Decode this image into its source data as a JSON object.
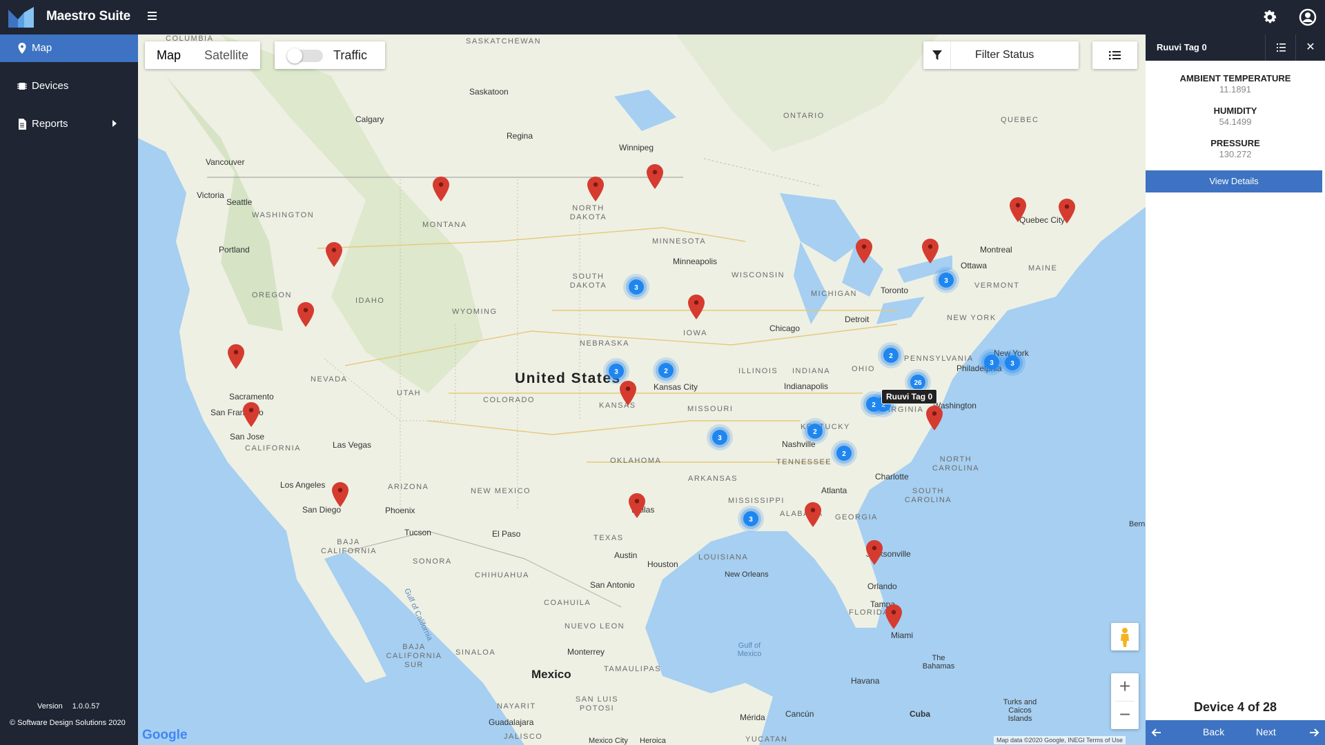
{
  "app": {
    "title": "Maestro Suite"
  },
  "sidebar": {
    "items": [
      {
        "label": "Map",
        "icon": "map-marker-icon",
        "active": true
      },
      {
        "label": "Devices",
        "icon": "chip-icon"
      },
      {
        "label": "Reports",
        "icon": "document-icon"
      }
    ],
    "version_label": "Version",
    "version": "1.0.0.57",
    "copyright": "© Software Design Solutions 2020"
  },
  "map": {
    "type_options": [
      "Map",
      "Satellite"
    ],
    "selected_type": "Map",
    "traffic_label": "Traffic",
    "traffic_on": false,
    "filter_label": "Filter Status",
    "tooltip": "Ruuvi Tag 0",
    "logo_text": "Google",
    "attribution": "Map data ©2020 Google, INEGI   Terms of Use",
    "labels": {
      "country_us": "United States",
      "country_mx": "Mexico",
      "cities": [
        "Calgary",
        "Saskatoon",
        "Regina",
        "Winnipeg",
        "Vancouver",
        "Victoria",
        "Seattle",
        "Portland",
        "Sacramento",
        "San Francisco",
        "San Jose",
        "Las Vegas",
        "Los Angeles",
        "San Diego",
        "Phoenix",
        "Tucson",
        "El Paso",
        "Dallas",
        "Austin",
        "Houston",
        "San Antonio",
        "Monterrey",
        "Kansas City",
        "Minneapolis",
        "Chicago",
        "Detroit",
        "Toronto",
        "Ottawa",
        "Montreal",
        "Quebec City",
        "Indianapolis",
        "Nashville",
        "Atlanta",
        "Charlotte",
        "Washington",
        "Philadelphia",
        "New York",
        "Jacksonville",
        "Orlando",
        "Tampa",
        "Miami",
        "New Orleans",
        "Havana",
        "Mérida",
        "Cancún",
        "Guadalajara"
      ],
      "states": [
        "COLUMBIA",
        "SASKATCHEWAN",
        "ONTARIO",
        "QUEBEC",
        "WASHINGTON",
        "MONTANA",
        "NORTH DAKOTA",
        "MINNESOTA",
        "SOUTH DAKOTA",
        "OREGON",
        "IDAHO",
        "WYOMING",
        "NEBRASKA",
        "IOWA",
        "WISCONSIN",
        "MICHIGAN",
        "NEVADA",
        "UTAH",
        "COLORADO",
        "KANSAS",
        "MISSOURI",
        "ILLINOIS",
        "INDIANA",
        "OHIO",
        "PENNSYLVANIA",
        "NEW YORK",
        "VERMONT",
        "MAINE",
        "CALIFORNIA",
        "ARIZONA",
        "NEW MEXICO",
        "OKLAHOMA",
        "ARKANSAS",
        "TENNESSEE",
        "KENTUCKY",
        "VIRGINIA",
        "NORTH CAROLINA",
        "SOUTH CAROLINA",
        "GEORGIA",
        "ALABAMA",
        "MISSISSIPPI",
        "LOUISIANA",
        "TEXAS",
        "FLORIDA",
        "SONORA",
        "CHIHUAHUA",
        "COAHUILA",
        "NUEVO LEON",
        "TAMAULIPAS",
        "SINALOA",
        "BAJA CALIFORNIA",
        "BAJA CALIFORNIA SUR",
        "NAYARIT",
        "SAN LUIS POTOSI",
        "JALISCO",
        "YUCATAN"
      ],
      "water": [
        "Gulf of Mexico",
        "Gulf of California"
      ],
      "other": [
        "The Bahamas",
        "Turks and Caicos Islands",
        "Cuba",
        "Mexico City",
        "Bern",
        "Heroica"
      ]
    },
    "clusters": [
      "3",
      "3",
      "2",
      "3",
      "3",
      "2",
      "2",
      "3",
      "26",
      "2",
      "2",
      "2",
      "3",
      "3"
    ],
    "colors": {
      "pin": "#d63b30",
      "cluster": "#1f86f0",
      "accent": "#3d73c2",
      "chrome": "#1f2533"
    }
  },
  "panel": {
    "title": "Ruuvi Tag 0",
    "metrics": [
      {
        "key": "AMBIENT TEMPERATURE",
        "value": "11.1891"
      },
      {
        "key": "HUMIDITY",
        "value": "54.1499"
      },
      {
        "key": "PRESSURE",
        "value": "130.272"
      }
    ],
    "details_label": "View Details",
    "device_count": "Device 4 of 28",
    "back_label": "Back",
    "next_label": "Next"
  }
}
